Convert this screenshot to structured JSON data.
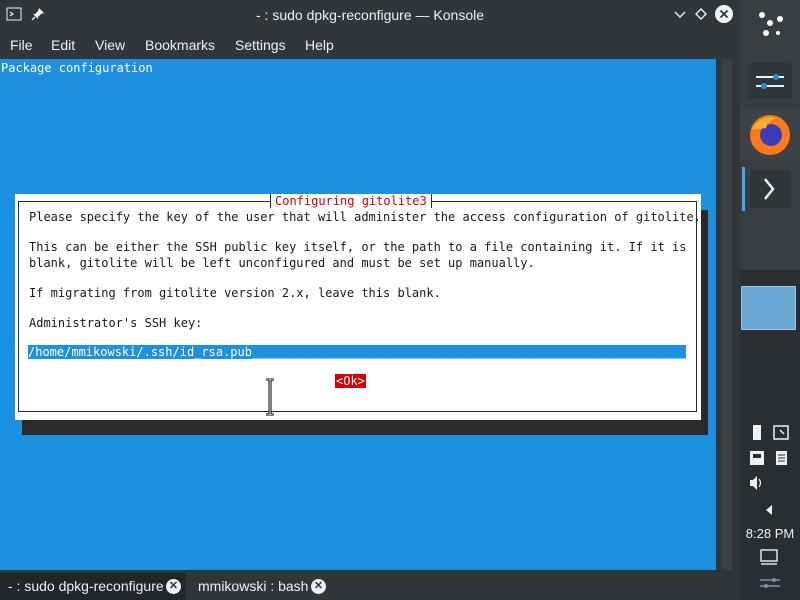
{
  "window": {
    "title": "- : sudo dpkg-reconfigure — Konsole"
  },
  "menu": [
    "File",
    "Edit",
    "View",
    "Bookmarks",
    "Settings",
    "Help"
  ],
  "terminal": {
    "header": "Package configuration",
    "dialog": {
      "title": "Configuring gitolite3",
      "line1": "Please specify the key of the user that will administer the access configuration of gitolite.",
      "line2": "This can be either the SSH public key itself, or the path to a file containing it. If it is",
      "line3": "blank, gitolite will be left unconfigured and must be set up manually.",
      "line4": "If migrating from gitolite version 2.x, leave this blank.",
      "line5": "Administrator's SSH key:",
      "key_value": "/home/mmikowski/.ssh/id_rsa.pub__________________________________________________________________",
      "ok_label": "<Ok>"
    }
  },
  "tabs": [
    {
      "label": "- : sudo dpkg-reconfigure"
    },
    {
      "label": "mmikowski : bash"
    }
  ],
  "panel": {
    "clock": "8:28 PM"
  },
  "colors": {
    "terminal_bg": "#1e90e0",
    "dialog_title": "#d60000",
    "ok_bg": "#d60000",
    "chrome": "#31363b"
  }
}
